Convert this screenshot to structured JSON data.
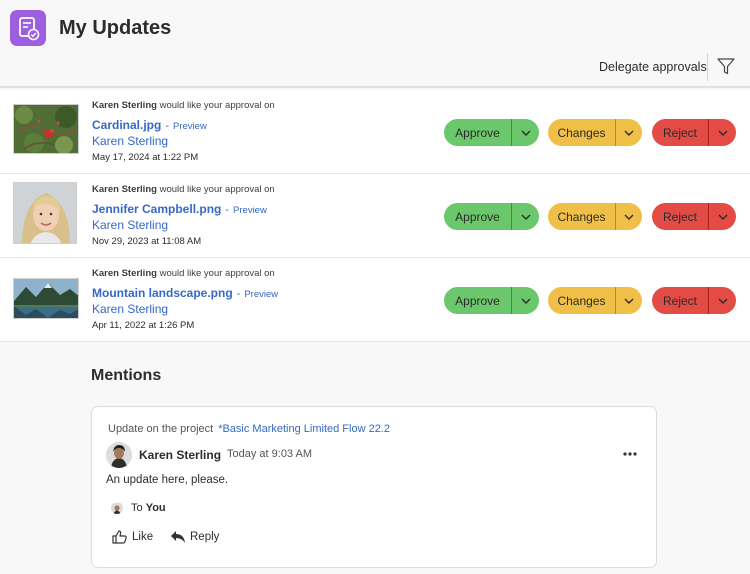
{
  "header": {
    "title": "My Updates",
    "app_icon": "updates-document-icon",
    "delegate_label": "Delegate approvals",
    "filter_icon": "filter-icon"
  },
  "colors": {
    "brand": "#9b5fe0",
    "approve": "#6bc76b",
    "changes": "#efbf47",
    "reject": "#e34b44",
    "link": "#3568c8"
  },
  "approvals": [
    {
      "requester": "Karen Sterling",
      "request_text": "would like your approval on",
      "file_name": "Cardinal.jpg",
      "separator": "-",
      "preview_label": "Preview",
      "person": "Karen Sterling",
      "date": "May 17, 2024 at 1:22 PM",
      "thumbnail": "cardinal-bird-image",
      "approve_label": "Approve",
      "changes_label": "Changes",
      "reject_label": "Reject"
    },
    {
      "requester": "Karen Sterling",
      "request_text": "would like your approval on",
      "file_name": "Jennifer Campbell.png",
      "separator": "-",
      "preview_label": "Preview",
      "person": "Karen Sterling",
      "date": "Nov 29, 2023 at 11:08 AM",
      "thumbnail": "portrait-photo-image",
      "approve_label": "Approve",
      "changes_label": "Changes",
      "reject_label": "Reject"
    },
    {
      "requester": "Karen Sterling",
      "request_text": "would like your approval on",
      "file_name": "Mountain landscape.png",
      "separator": "-",
      "preview_label": "Preview",
      "person": "Karen Sterling",
      "date": "Apr 11, 2022 at 1:26 PM",
      "thumbnail": "mountain-lake-image",
      "approve_label": "Approve",
      "changes_label": "Changes",
      "reject_label": "Reject"
    }
  ],
  "mentions": {
    "title": "Mentions",
    "card": {
      "project_prefix": "Update on the project",
      "project_name": "*Basic Marketing Limited Flow 22.2",
      "author": "Karen Sterling",
      "dot": "·",
      "timestamp": "Today at 9:03 AM",
      "message": "An update here, please.",
      "to_prefix": "To",
      "to_target": "You",
      "like_label": "Like",
      "reply_label": "Reply"
    }
  }
}
